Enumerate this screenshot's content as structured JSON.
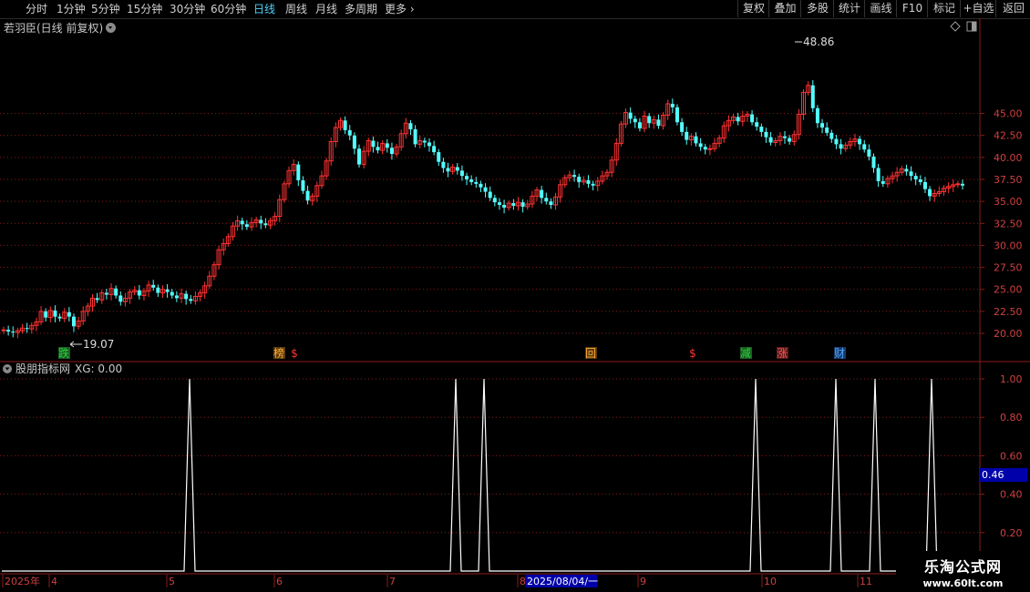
{
  "toolbar": {
    "left": [
      {
        "label": "分时",
        "active": false
      },
      {
        "label": "1分钟",
        "active": false
      },
      {
        "label": "5分钟",
        "active": false
      },
      {
        "label": "15分钟",
        "active": false
      },
      {
        "label": "30分钟",
        "active": false
      },
      {
        "label": "60分钟",
        "active": false
      },
      {
        "label": "日线",
        "active": true
      },
      {
        "label": "周线",
        "active": false
      },
      {
        "label": "月线",
        "active": false
      },
      {
        "label": "多周期",
        "active": false
      },
      {
        "label": "更多",
        "active": false
      }
    ],
    "right": [
      "复权",
      "叠加",
      "多股",
      "统计",
      "画线",
      "F10",
      "标记",
      "+自选",
      "返回"
    ]
  },
  "chart": {
    "title": "若羽臣(日线 前复权)",
    "high_marker": "48.86",
    "low_marker": "19.07",
    "price_axis": [
      "45.00",
      "42.50",
      "40.00",
      "37.50",
      "35.00",
      "32.50",
      "30.00",
      "27.50",
      "25.00",
      "22.50",
      "20.00"
    ],
    "events": [
      {
        "label": "跌",
        "color": "#2ecc40",
        "bg": "#1a5e20"
      },
      {
        "label": "榜",
        "color": "#ffaa33",
        "bg": "#5a3a10"
      },
      {
        "label": "$",
        "color": "#ff3333",
        "bg": ""
      },
      {
        "label": "回",
        "color": "#ffaa33",
        "bg": "#5a3a10"
      },
      {
        "label": "$",
        "color": "#ff3333",
        "bg": ""
      },
      {
        "label": "减",
        "color": "#2ecc40",
        "bg": "#1a5e20"
      },
      {
        "label": "涨",
        "color": "#ff5555",
        "bg": "#5a1a1a"
      },
      {
        "label": "财",
        "color": "#4fa3ff",
        "bg": "#183a66"
      }
    ]
  },
  "indicator": {
    "title": "股朋指标网",
    "xg_label": "XG: 0.00",
    "axis": [
      "1.00",
      "0.80",
      "0.60",
      "0.40",
      "0.20"
    ],
    "current_value": "0.46"
  },
  "time_axis": {
    "labels": [
      "2025年",
      "4",
      "5",
      "6",
      "7",
      "8",
      "9",
      "10",
      "11"
    ],
    "cursor_date": "2025/08/04/一"
  },
  "watermark": {
    "line1": "乐淘公式网",
    "line2": "www.60lt.com"
  },
  "chart_data": {
    "type": "candlestick+indicator",
    "price_range": [
      19.07,
      48.86
    ],
    "indicator_series": {
      "name": "XG",
      "values": [
        0,
        0,
        0,
        0,
        0,
        0,
        0,
        0,
        0,
        0,
        0,
        0,
        0,
        0,
        0,
        0,
        0,
        0,
        0,
        0,
        0,
        0,
        0,
        0,
        0,
        0,
        0,
        0,
        0,
        0,
        0,
        0,
        0,
        0,
        0,
        0,
        0,
        0,
        0,
        0,
        0,
        0,
        0,
        0,
        0,
        0,
        0,
        0,
        0,
        0,
        0,
        0,
        0,
        0,
        0,
        0,
        0,
        0,
        0,
        0,
        0,
        0,
        0,
        0,
        0,
        0,
        0,
        0,
        0,
        0,
        0,
        0,
        0,
        0,
        0,
        0,
        0,
        0,
        0,
        0,
        0,
        0,
        0,
        0,
        0,
        0,
        0,
        0,
        0,
        0,
        0,
        0,
        0,
        0,
        0,
        0,
        0,
        0,
        0,
        0,
        0,
        0,
        0,
        0,
        0,
        0,
        0,
        0,
        0,
        0,
        0,
        0,
        0,
        0,
        0,
        0,
        0,
        0,
        0,
        0,
        0,
        0,
        0,
        0,
        0,
        0,
        0,
        0,
        0,
        0,
        0,
        0,
        0,
        0,
        0,
        0,
        0,
        0,
        0,
        0,
        0,
        0,
        0,
        0,
        0,
        0,
        0,
        0,
        0,
        0,
        0,
        0,
        0,
        0,
        0,
        0,
        0,
        0,
        0,
        0,
        0,
        0,
        0,
        0,
        0,
        0,
        0
      ]
    },
    "indicator_spikes_at_dates": [
      "2025-05",
      "2025-07",
      "2025-07",
      "2025-10",
      "2025-10",
      "2025-11",
      "2025-11"
    ]
  }
}
